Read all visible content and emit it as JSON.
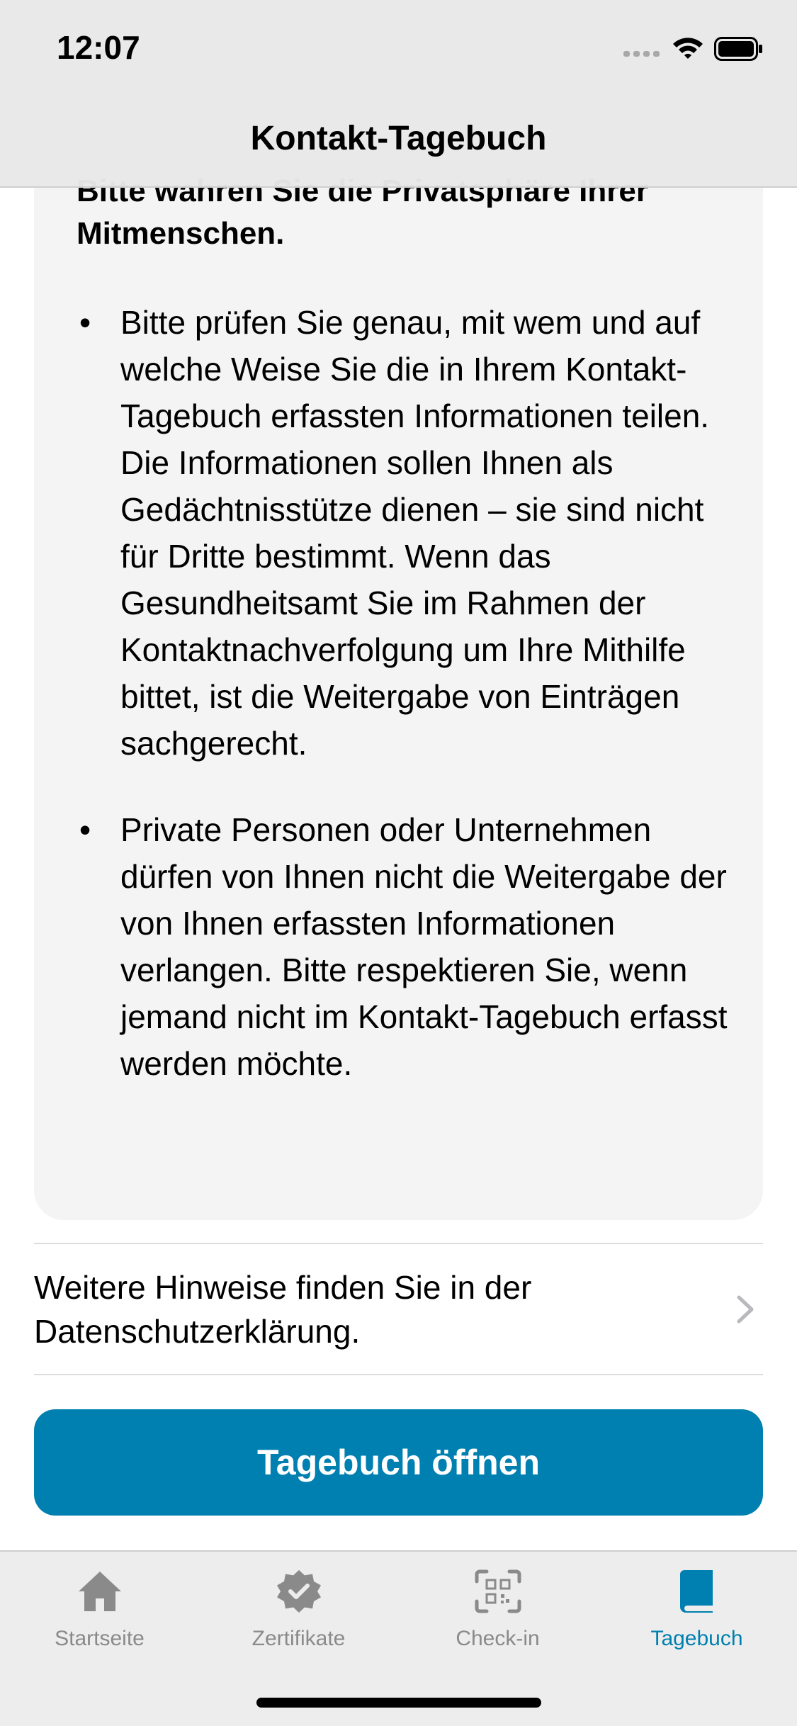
{
  "status_bar": {
    "time": "12:07"
  },
  "nav": {
    "title": "Kontakt-Tagebuch"
  },
  "card": {
    "heading": "Bitte wahren Sie die Privatsphäre Ihrer Mitmenschen.",
    "bullets": [
      "Bitte prüfen Sie genau, mit wem und auf welche Weise Sie die in Ihrem Kontakt-Tagebuch erfassten Informationen teilen. Die Informationen sollen Ihnen als Gedächtnisstütze dienen – sie sind nicht für Dritte bestimmt. Wenn das Gesundheitsamt Sie im Rahmen der Kontaktnachverfolgung um Ihre Mithilfe bittet, ist die Weitergabe von Einträgen sachgerecht.",
      "Private Personen oder Unternehmen dürfen von Ihnen nicht die Weitergabe der von Ihnen erfassten Informationen verlangen. Bitte respektieren Sie, wenn jemand nicht im Kontakt-Tagebuch erfasst werden möchte."
    ],
    "bullet_symbol": "•"
  },
  "privacy_link": {
    "label": "Weitere Hinweise finden Sie in der Datenschutzerklärung."
  },
  "primary_button": {
    "label": "Tagebuch öffnen",
    "color": "#0080b0"
  },
  "tab_bar": {
    "tabs": [
      {
        "label": "Startseite",
        "icon": "house-icon",
        "active": false
      },
      {
        "label": "Zertifikate",
        "icon": "badge-check-icon",
        "active": false
      },
      {
        "label": "Check-in",
        "icon": "qr-code-icon",
        "active": false
      },
      {
        "label": "Tagebuch",
        "icon": "book-icon",
        "active": true
      }
    ],
    "active_color": "#0080b0",
    "inactive_color": "#8a8a8a"
  }
}
